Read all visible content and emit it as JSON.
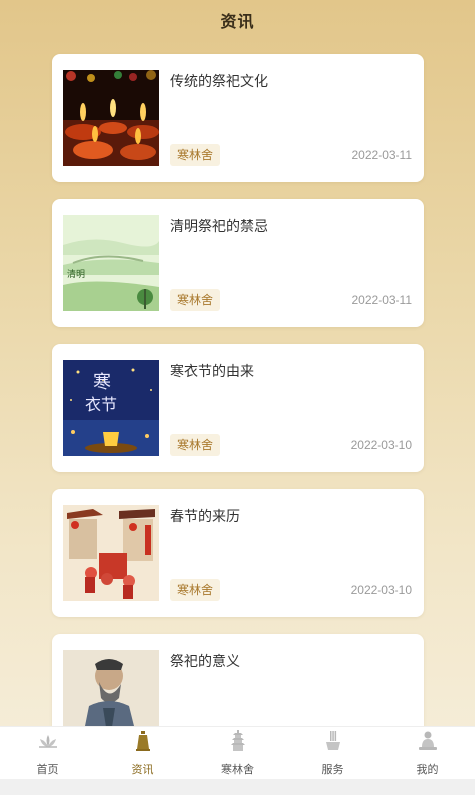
{
  "header": {
    "title": "资讯"
  },
  "articles": [
    {
      "title": "传统的祭祀文化",
      "tag": "寒林舍",
      "date": "2022-03-11",
      "image": "candles-image"
    },
    {
      "title": "清明祭祀的禁忌",
      "tag": "寒林舍",
      "date": "2022-03-11",
      "image": "qingming-image"
    },
    {
      "title": "寒衣节的由来",
      "tag": "寒林舍",
      "date": "2022-03-10",
      "image": "hanyijie-image"
    },
    {
      "title": "春节的来历",
      "tag": "寒林舍",
      "date": "2022-03-10",
      "image": "spring-festival-image"
    },
    {
      "title": "祭祀的意义",
      "tag": "",
      "date": "",
      "image": "confucius-image"
    }
  ],
  "tabbar": {
    "items": [
      {
        "label": "首页",
        "icon": "lotus-icon"
      },
      {
        "label": "资讯",
        "icon": "bell-icon",
        "active": true
      },
      {
        "label": "寒林舍",
        "icon": "pagoda-icon"
      },
      {
        "label": "服务",
        "icon": "incense-icon"
      },
      {
        "label": "我的",
        "icon": "buddha-icon"
      }
    ]
  },
  "colors": {
    "accent": "#a8782c",
    "active_tab": "#8a6a1e",
    "tag_bg": "#f8f1e0"
  }
}
